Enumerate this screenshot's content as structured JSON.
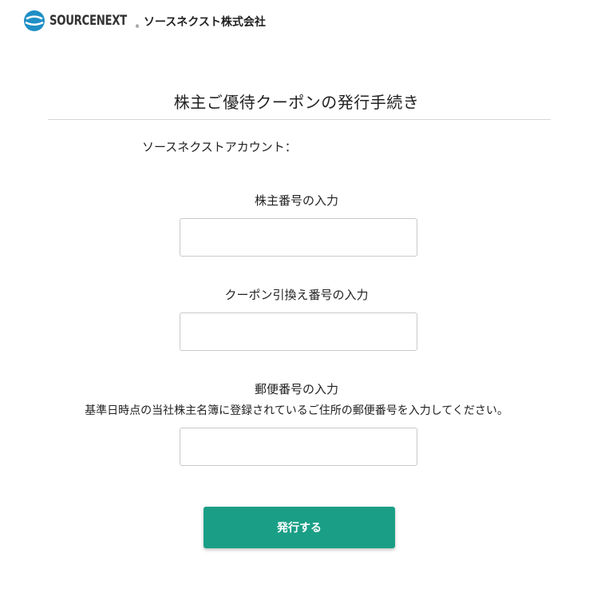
{
  "header": {
    "brand_word": "SOURCENEXT",
    "brand_reg": "®",
    "company_name": "ソースネクスト株式会社",
    "logo_icon": "sourcenext-logo-icon",
    "logo_colors": {
      "mark": "#1f8fc5",
      "word": "#333333"
    }
  },
  "page": {
    "title": "株主ご優待クーポンの発行手続き"
  },
  "account": {
    "label": "ソースネクストアカウント：",
    "value": ""
  },
  "fields": {
    "shareholder_number": {
      "label": "株主番号の入力",
      "value": "",
      "placeholder": ""
    },
    "coupon_code": {
      "label": "クーポン引換え番号の入力",
      "value": "",
      "placeholder": ""
    },
    "postal_code": {
      "label": "郵便番号の入力",
      "note": "基準日時点の当社株主名簿に登録されているご住所の郵便番号を入力してください。",
      "value": "",
      "placeholder": ""
    }
  },
  "actions": {
    "submit_label": "発行する"
  },
  "colors": {
    "accent": "#1a9f86",
    "divider": "#d6d6d6",
    "input_border": "#c9c9c9"
  }
}
